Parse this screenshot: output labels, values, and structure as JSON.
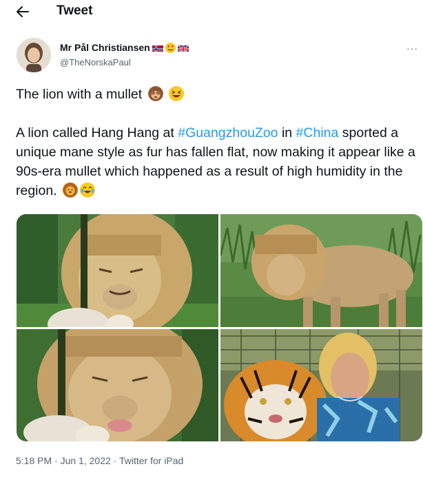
{
  "header": {
    "title": "Tweet",
    "back_icon": "arrow-left-icon"
  },
  "author": {
    "display_name": "Mr Pål Christiansen",
    "handle": "@TheNorskaPaul",
    "badges": [
      "norway-flag-icon",
      "heart-eyes-emoji",
      "uk-flag-icon"
    ]
  },
  "tweet": {
    "line1_text": "The lion with a mullet",
    "line1_emojis": [
      "see-no-evil-monkey-emoji",
      "grinning-squinting-emoji"
    ],
    "seg1": "A lion called Hang Hang at ",
    "hashtag1": "#GuangzhouZoo",
    "seg2": " in ",
    "hashtag2": "#China",
    "seg3": " sported a unique mane style as fur has fallen flat, now making it appear like a 90s-era mullet which happened as a result of high humidity in the region.",
    "end_emojis": [
      "lion-emoji",
      "tears-of-joy-emoji"
    ]
  },
  "media": [
    {
      "name": "lion-closeup-photo"
    },
    {
      "name": "lion-standing-photo"
    },
    {
      "name": "lion-tongue-photo"
    },
    {
      "name": "tiger-and-man-photo"
    }
  ],
  "meta": {
    "time": "5:18 PM",
    "separator": " · ",
    "date": "Jun 1, 2022",
    "source": "Twitter for iPad"
  },
  "colors": {
    "link": "#1d9bf0",
    "text": "#0f1419",
    "secondary": "#536471"
  }
}
